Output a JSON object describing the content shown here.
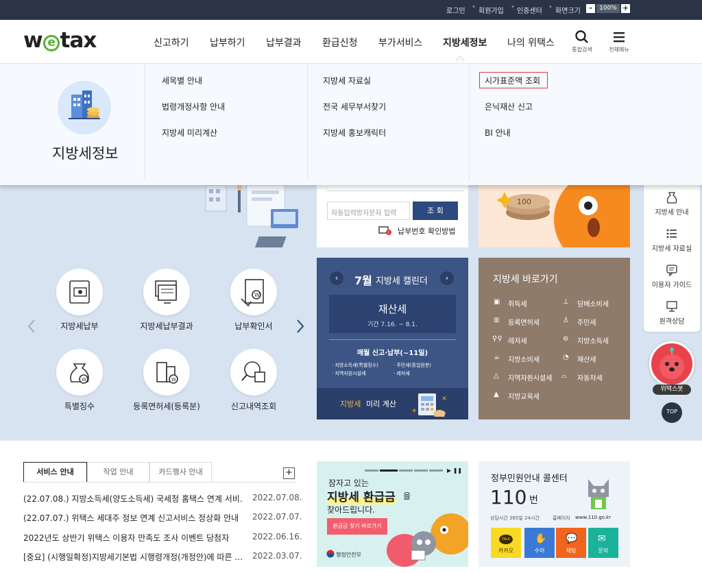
{
  "topbar": {
    "login": "로그인",
    "join": "회원가입",
    "cert": "인증센터",
    "screen_size": "화면크기",
    "zoom_minus": "-",
    "zoom": "100%",
    "zoom_plus": "+"
  },
  "header": {
    "logo_w": "w",
    "logo_e": "e",
    "logo_tax": "tax",
    "nav": [
      "신고하기",
      "납부하기",
      "납부결과",
      "환급신청",
      "부가서비스",
      "지방세정보",
      "나의 위택스"
    ],
    "search_label": "통합검색",
    "menu_label": "전체메뉴"
  },
  "mega": {
    "title": "지방세정보",
    "col1": [
      "세목별 안내",
      "법령개정사항 안내",
      "지방세 미리계산"
    ],
    "col2": [
      "지방세 자료실",
      "전국 세무부서찾기",
      "지방세 홍보캐릭터"
    ],
    "col3": [
      "시가표준액 조회",
      "은닉재산 신고",
      "BI 안내"
    ]
  },
  "payment": {
    "auto_placeholder": "자동입력방지문자 입력",
    "query_button": "조 회",
    "check_link": "납부번호 확인방법"
  },
  "services": [
    {
      "label": "지방세납부",
      "icon": "tax-payment-icon"
    },
    {
      "label": "지방세납부결과",
      "icon": "payment-result-icon"
    },
    {
      "label": "납부확인서",
      "icon": "payment-certificate-icon"
    },
    {
      "label": "특별징수",
      "icon": "money-bag-icon"
    },
    {
      "label": "등록면허세(등록분)",
      "icon": "building-icon"
    },
    {
      "label": "신고내역조회",
      "icon": "search-history-icon"
    }
  ],
  "calendar": {
    "month": "7월",
    "title": "지방세 캘린더",
    "tax_name": "재산세",
    "period": "기간 7.16. ~ 8.1.",
    "monthly": "매월 신고·납부(~11일)",
    "items": [
      "지방소득세(특별징수)",
      "주민세(종업원분)",
      "지역자원시설세",
      "레저세"
    ],
    "calc_prefix": "지방세",
    "calc_suffix": "미리 계산"
  },
  "shortcuts": {
    "title": "지방세 바로가기",
    "left": [
      {
        "label": "취득세",
        "icon": "acquisition-tax-icon"
      },
      {
        "label": "등록면허세",
        "icon": "registration-tax-icon"
      },
      {
        "label": "레저세",
        "icon": "bicycle-icon"
      },
      {
        "label": "지방소비세",
        "icon": "consumption-tax-icon"
      },
      {
        "label": "지역자원시설세",
        "icon": "resource-tax-icon"
      },
      {
        "label": "지방교육세",
        "icon": "education-tax-icon"
      }
    ],
    "right": [
      {
        "label": "담배소비세",
        "icon": "tobacco-icon"
      },
      {
        "label": "주민세",
        "icon": "resident-icon"
      },
      {
        "label": "지방소득세",
        "icon": "income-tax-icon"
      },
      {
        "label": "재산세",
        "icon": "property-tax-icon"
      },
      {
        "label": "자동차세",
        "icon": "car-icon"
      }
    ]
  },
  "quick": {
    "items": [
      "지방세 안내",
      "지방세 자료실",
      "이용자 가이드",
      "원격상담"
    ],
    "bot_label": "위택스봇",
    "top_label": "TOP"
  },
  "notice": {
    "tabs": [
      "서비스 안내",
      "작업 안내",
      "카드행사 안내"
    ],
    "plus": "+",
    "rows": [
      {
        "title": "(22.07.08.) 지방소득세(양도소득세) 국세청 홈택스 연계 서비…",
        "date": "2022.07.08."
      },
      {
        "title": "(22.07.07.) 위택스 세대주 정보 연계 신고서비스 정상화 안내",
        "date": "2022.07.07."
      },
      {
        "title": "2022년도 상반기 위택스 이용자 만족도 조사 이벤트 당첨자",
        "date": "2022.06.16."
      },
      {
        "title": "[중요] (시행일확정)지방세기본법 시행령개정(개정안)에 따른 …",
        "date": "2022.03.07."
      }
    ]
  },
  "refund_banner": {
    "line1": "잠자고 있는",
    "highlight": "지방세 환급금",
    "particle": "을",
    "line3": "찾아드립니다.",
    "button": "환급금 찾기 바로가기",
    "ministry": "행정안전부"
  },
  "callcenter": {
    "title": "정부민원안내 콜센터",
    "number": "110",
    "unit": "번",
    "hours": "상담시간 365일 24시간",
    "homepage_label": "홈페이지",
    "homepage": "www.110.go.kr",
    "buttons": [
      "카카오",
      "수어",
      "채팅",
      "문자"
    ],
    "kakao_badge": "TALK"
  }
}
